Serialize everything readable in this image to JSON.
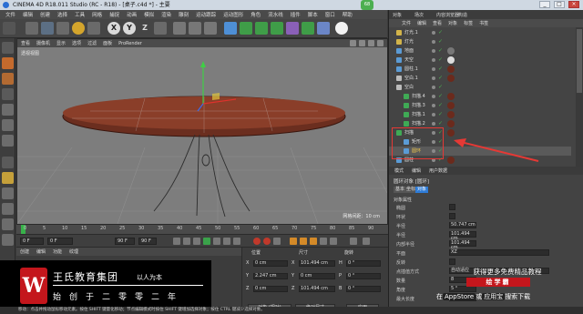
{
  "window": {
    "title": "CINEMA 4D R18.011 Studio (RC - R18) - [桌子.c4d *] - 主要",
    "badge": "68"
  },
  "menubar": {
    "items": [
      "文件",
      "编辑",
      "创建",
      "选择",
      "工具",
      "网格",
      "捕捉",
      "动画",
      "模拟",
      "渲染",
      "雕刻",
      "运动跟踪",
      "运动图形",
      "角色",
      "流水线",
      "插件",
      "脚本",
      "窗口",
      "帮助"
    ]
  },
  "viewport": {
    "menu": [
      "查看",
      "摄像机",
      "显示",
      "选项",
      "过滤",
      "面板",
      "ProRender"
    ],
    "label": "透视视图",
    "grid_info": "网格间距：10 cm"
  },
  "timeline": {
    "ticks": [
      "0",
      "5",
      "10",
      "15",
      "20",
      "25",
      "30",
      "35",
      "40",
      "45",
      "50",
      "55",
      "60",
      "65",
      "70",
      "75",
      "80",
      "85",
      "90"
    ],
    "end_frame": "0 F"
  },
  "transport": {
    "start": "0 F",
    "current": "0 F",
    "end": "90 F",
    "end2": "90 F"
  },
  "materials": {
    "menu": [
      "创建",
      "编辑",
      "功能",
      "纹理"
    ]
  },
  "coords": {
    "headers": [
      "位置",
      "尺寸",
      "旋转"
    ],
    "rows": [
      {
        "axis": "X",
        "pos": "0 cm",
        "size": "101.494 cm",
        "rot_axis": "H",
        "rot": "0 °"
      },
      {
        "axis": "Y",
        "pos": "2.247 cm",
        "size": "0 cm",
        "rot_axis": "P",
        "rot": "0 °"
      },
      {
        "axis": "Z",
        "pos": "0 cm",
        "size": "101.494 cm",
        "rot_axis": "B",
        "rot": "0 °"
      }
    ],
    "mode": "对象 (相对)",
    "size_mode": "绝对尺寸",
    "apply": "应用"
  },
  "ad": {
    "logo": "W",
    "brand": "王氏教育集团",
    "slogan": "以人为本",
    "sub": "始创于二零零二年",
    "panel_line1": "获得更多免费精品教程",
    "panel_line2": "绘学霸",
    "panel_line3_pre": "在",
    "panel_line3_store": "AppStore",
    "panel_line3_mid": "或",
    "panel_line3_app": "应用宝",
    "panel_line3_post": "搜索下载"
  },
  "status": {
    "text": "移动：点击并拖动鼠标移动元素。按住 SHIFT 键量化移动；节点编辑模式时按住 SHIFT 键增加选择对象；按住 CTRL 键减少选择对象。"
  },
  "objects": {
    "tabs": [
      "对象",
      "场次",
      "内容浏览器",
      "构造"
    ],
    "menu": [
      "文件",
      "编辑",
      "查看",
      "对象",
      "标签",
      "书签"
    ],
    "rows": [
      {
        "name": "灯光.1",
        "color": "#d2b44a",
        "indent": 0,
        "tag": ""
      },
      {
        "name": "灯光",
        "color": "#d2b44a",
        "indent": 0,
        "tag": ""
      },
      {
        "name": "地面",
        "color": "#5b9bd5",
        "indent": 0,
        "tag": "#777"
      },
      {
        "name": "天空",
        "color": "#5b9bd5",
        "indent": 0,
        "tag": "#ddd"
      },
      {
        "name": "圆柱.1",
        "color": "#5b9bd5",
        "indent": 0,
        "tag": "#6b2a1c"
      },
      {
        "name": "空白.1",
        "color": "#bbb",
        "indent": 0,
        "tag": "#6b2a1c"
      },
      {
        "name": "空白",
        "color": "#bbb",
        "indent": 0,
        "tag": ""
      },
      {
        "name": "扫描.4",
        "color": "#3faa55",
        "indent": 1,
        "tag": "#6b2a1c"
      },
      {
        "name": "扫描.3",
        "color": "#3faa55",
        "indent": 1,
        "tag": "#6b2a1c"
      },
      {
        "name": "扫描.1",
        "color": "#3faa55",
        "indent": 1,
        "tag": "#6b2a1c"
      },
      {
        "name": "扫描.2",
        "color": "#3faa55",
        "indent": 1,
        "tag": "#6b2a1c"
      },
      {
        "name": "扫描",
        "color": "#3faa55",
        "indent": 0,
        "tag": "#6b2a1c"
      },
      {
        "name": "矩形",
        "color": "#5b9bd5",
        "indent": 1,
        "tag": ""
      },
      {
        "name": "圆环",
        "color": "#5b9bd5",
        "indent": 1,
        "tag": ""
      },
      {
        "name": "圆柱",
        "color": "#5b9bd5",
        "indent": 0,
        "tag": "#6b2a1c"
      }
    ],
    "selected_row": 13
  },
  "attributes": {
    "tabs": [
      "模式",
      "编辑",
      "用户数据"
    ],
    "title": "圆环对象 [圆环]",
    "sub_tabs": [
      "基本",
      "坐标",
      "对象"
    ],
    "active_sub_tab": 2,
    "section": "对象属性",
    "rows": [
      {
        "label": "椭圆",
        "value": ""
      },
      {
        "label": "环状",
        "value": ""
      },
      {
        "label": "半径",
        "value": "50.747 cm"
      },
      {
        "label": "半径",
        "value": "101.494 cm"
      },
      {
        "label": "内部半径",
        "value": "101.494 cm"
      },
      {
        "label": "平面",
        "value": "XZ"
      },
      {
        "label": "反转",
        "value": ""
      },
      {
        "label": "点插值方式",
        "value": "自动适应"
      },
      {
        "label": "数量",
        "value": "8"
      },
      {
        "label": "角度",
        "value": "5 °"
      },
      {
        "label": "最大长度",
        "value": "5 cm"
      }
    ]
  },
  "colors": {
    "accent_blue": "#2e7bd6",
    "highlight_red": "#e53935",
    "brand_red": "#c4161c",
    "play_green": "#3aa24a"
  }
}
